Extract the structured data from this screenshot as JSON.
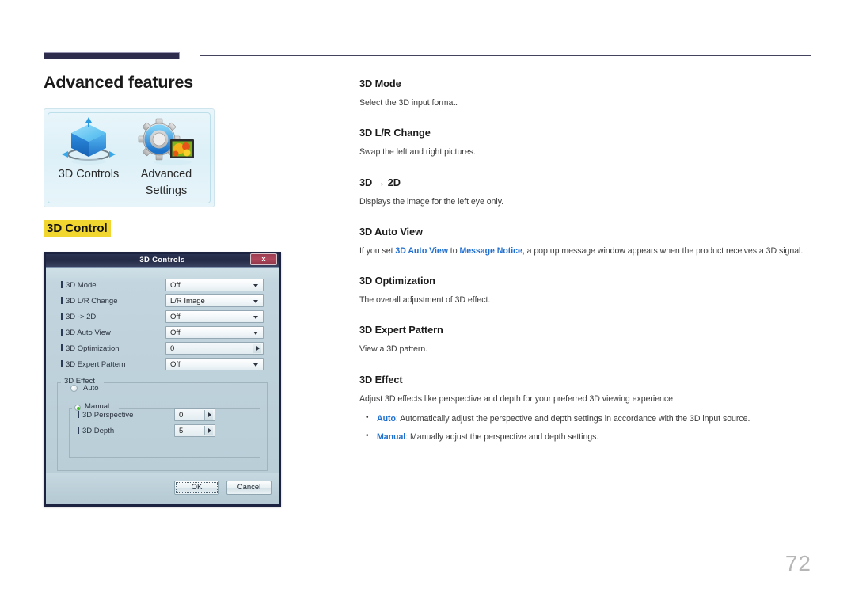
{
  "header": {
    "rule_thick_color": "#2e2d4d",
    "rule_thin_color": "#44435e"
  },
  "page": {
    "title": "Advanced features",
    "number": "72"
  },
  "thumbnail_panel": {
    "tiles": [
      {
        "icon": "3d-cube-icon",
        "caption": "3D Controls"
      },
      {
        "icon": "gear-picture-icon",
        "caption": "Advanced\nSettings"
      }
    ]
  },
  "section_label": {
    "text": "3D Control",
    "highlight_color": "#f2d630"
  },
  "dialog": {
    "title": "3D Controls",
    "close_label": "x",
    "rows": [
      {
        "label": "3D Mode",
        "value": "Off",
        "control": "dropdown"
      },
      {
        "label": "3D L/R Change",
        "value": "L/R Image",
        "control": "dropdown"
      },
      {
        "label": "3D -> 2D",
        "value": "Off",
        "control": "dropdown"
      },
      {
        "label": "3D Auto View",
        "value": "Off",
        "control": "dropdown"
      },
      {
        "label": "3D Optimization",
        "value": "0",
        "control": "spinner"
      },
      {
        "label": "3D Expert Pattern",
        "value": "Off",
        "control": "dropdown"
      }
    ],
    "effect_group": {
      "legend": "3D Effect",
      "auto": {
        "label": "Auto",
        "selected": false
      },
      "manual": {
        "label": "Manual",
        "selected": true,
        "rows": [
          {
            "label": "3D Perspective",
            "value": "0",
            "control": "spinner"
          },
          {
            "label": "3D Depth",
            "value": "5",
            "control": "spinner"
          }
        ]
      }
    },
    "buttons": {
      "ok": "OK",
      "cancel": "Cancel"
    }
  },
  "topics": [
    {
      "heading": "3D Mode",
      "body": "Select the 3D input format."
    },
    {
      "heading": "3D L/R Change",
      "body": "Swap the left and right pictures."
    },
    {
      "heading": "3D → 2D",
      "body": "Displays the image for the left eye only."
    },
    {
      "heading": "3D Auto View",
      "body_parts": {
        "pre": "If you set ",
        "link1": "3D Auto View",
        "mid": " to ",
        "link2": "Message Notice",
        "post": ", a pop up message window appears when the product receives a 3D signal."
      }
    },
    {
      "heading": "3D Optimization",
      "body": "The overall adjustment of 3D effect."
    },
    {
      "heading": "3D Expert Pattern",
      "body": "View a 3D pattern."
    },
    {
      "heading": "3D Effect",
      "body": "Adjust 3D effects like perspective and depth for your preferred 3D viewing experience.",
      "bullets": [
        {
          "term": "Auto",
          "text": ": Automatically adjust the perspective and depth settings in accordance with the 3D input source."
        },
        {
          "term": "Manual",
          "text": ": Manually adjust the perspective and depth settings."
        }
      ]
    }
  ],
  "colors": {
    "link": "#1f6fd0",
    "highlight": "#f2d630",
    "dialog_border": "#1c2340"
  }
}
